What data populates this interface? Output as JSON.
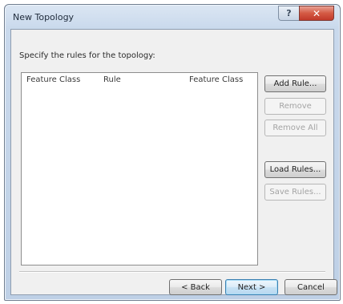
{
  "window": {
    "title": "New Topology",
    "caption": {
      "help_glyph": "?",
      "close_glyph": "✕"
    }
  },
  "page": {
    "instruction": "Specify the rules for the topology:"
  },
  "rules_list": {
    "columns": [
      "Feature Class",
      "Rule",
      "Feature Class"
    ],
    "rows": []
  },
  "side_buttons": {
    "add_rule": "Add Rule...",
    "remove": "Remove",
    "remove_all": "Remove All",
    "load_rules": "Load Rules...",
    "save_rules": "Save Rules..."
  },
  "nav_buttons": {
    "back": "< Back",
    "next": "Next >",
    "cancel": "Cancel"
  },
  "colors": {
    "title_bar": "#c9d9ec",
    "close_button": "#c1392a",
    "dialog_face": "#f0f0f0",
    "default_button_border": "#3c7fb1"
  },
  "icons": [
    "help-icon",
    "close-icon"
  ]
}
